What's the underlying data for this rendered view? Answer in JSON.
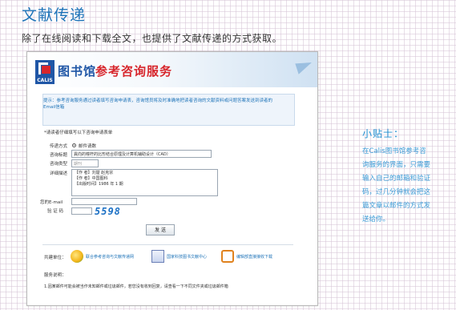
{
  "page": {
    "title": "文献传递",
    "intro": "除了在线阅读和下载全文，也提供了文献传递的方式获取。"
  },
  "screenshot": {
    "header": {
      "logo_text": "CALIS",
      "library": "图书馆",
      "service": "参考咨询服务"
    },
    "tip": "提示：参考咨询服务通过读者填写咨询申请表，咨询馆员将及时准确地把读者咨询的文献资料或问题答案发送到读者的Email信箱",
    "required_note": "*请读者仔细填写以下咨询申请表单",
    "form": {
      "method_label": "传递方式",
      "method_option": "邮件请数",
      "title_label": "咨询标题",
      "title_value": "異向的幢杆的比形结合原理及计算机辅助设计（CAD）",
      "type_label": "咨询类型",
      "type_placeholder": "期刊",
      "desc_label": "详细描述",
      "desc_lines": [
        "【作 者】刘楚 赵克宗",
        "【作 者】中国图科",
        "【出版时间】1986 年 1 期"
      ],
      "email_label": "您的E-mail",
      "code_label": "验 证 码",
      "captcha": "5598",
      "send_label": "发 送"
    },
    "partners": {
      "label": "共建单位：",
      "items": [
        {
          "name": "联合参考咨询与文献传递网",
          "icon": "globe-icon"
        },
        {
          "name": "国家科技图书文献中心",
          "icon": "nstl-icon"
        },
        {
          "name": "编辑部直接接收下载",
          "icon": "adobe-icon"
        }
      ]
    },
    "help": {
      "label": "服务说明：",
      "text": "1.因某邮件可能会被当作未知邮件或垃圾邮件，若您没有收到回复，请查看一下不同文件夹或垃圾邮件箱"
    }
  },
  "tips": {
    "title": "小贴士：",
    "lines": [
      "在Calis图书馆参考咨",
      "询服务的界面，只需要",
      "输入自己的邮箱和验证",
      "码，过几分钟就会把这",
      "篇文章以邮件的方式发",
      "送给你。"
    ]
  },
  "colors": {
    "accent": "#1e73b8",
    "tip_text": "#3b9bd6",
    "brand_red": "#d7262c",
    "brand_blue": "#1f56a6",
    "grid": "#d6c4d6"
  }
}
